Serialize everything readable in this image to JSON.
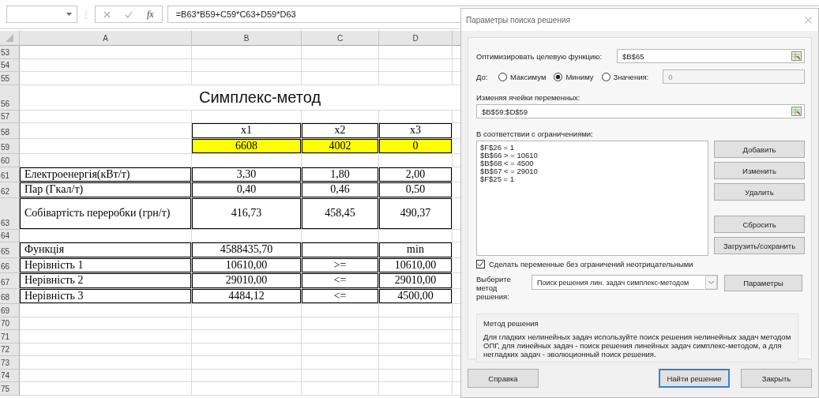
{
  "formula_bar": {
    "separator": "⋮",
    "function_symbol": "fx",
    "formula": "=B63*B59+C59*C63+D59*D63"
  },
  "sheet": {
    "columns": [
      "A",
      "B",
      "C",
      "D"
    ],
    "rows": [
      {
        "number": "53",
        "kind": "blank"
      },
      {
        "number": "54",
        "kind": "blank"
      },
      {
        "number": "55",
        "kind": "blank"
      },
      {
        "number": "56",
        "kind": "title",
        "title": "Симплекс-метод"
      },
      {
        "number": "57",
        "kind": "blank"
      },
      {
        "number": "58",
        "kind": "data",
        "highlighted": false,
        "cells": [
          {
            "boxed": false
          },
          {
            "text": "x1",
            "boxed": true
          },
          {
            "text": "x2",
            "boxed": true
          },
          {
            "text": "x3",
            "boxed": true
          }
        ]
      },
      {
        "number": "59",
        "kind": "data",
        "highlighted": true,
        "cells": [
          {
            "boxed": false
          },
          {
            "text": "6608",
            "boxed": true
          },
          {
            "text": "4002",
            "boxed": true
          },
          {
            "text": "0",
            "boxed": true
          }
        ]
      },
      {
        "number": "60",
        "kind": "blank"
      },
      {
        "number": "61",
        "kind": "data",
        "highlighted": false,
        "cells": [
          {
            "text": "Електроенергія(кВт/т)",
            "boxed": true
          },
          {
            "text": "3,30",
            "boxed": true
          },
          {
            "text": "1,80",
            "boxed": true
          },
          {
            "text": "2,00",
            "boxed": true
          }
        ]
      },
      {
        "number": "62",
        "kind": "data",
        "highlighted": false,
        "cells": [
          {
            "text": "Пар (Гкал/т)",
            "boxed": true
          },
          {
            "text": "0,40",
            "boxed": true
          },
          {
            "text": "0,46",
            "boxed": true
          },
          {
            "text": "0,50",
            "boxed": true
          }
        ]
      },
      {
        "number": "63",
        "kind": "tall",
        "highlighted": false,
        "cells": [
          {
            "text": "Собівартість переробки (грн/т)",
            "boxed": true
          },
          {
            "text": "416,73",
            "boxed": true
          },
          {
            "text": "458,45",
            "boxed": true
          },
          {
            "text": "490,37",
            "boxed": true
          }
        ]
      },
      {
        "number": "64",
        "kind": "blank"
      },
      {
        "number": "65",
        "kind": "data",
        "highlighted": false,
        "cells": [
          {
            "text": "Функція",
            "boxed": true
          },
          {
            "text": "4588435,70",
            "boxed": true
          },
          {
            "boxed": true
          },
          {
            "text": "min",
            "boxed": true
          }
        ]
      },
      {
        "number": "66",
        "kind": "data",
        "highlighted": false,
        "cells": [
          {
            "text": "Нерівність 1",
            "boxed": true
          },
          {
            "text": "10610,00",
            "boxed": true
          },
          {
            "text": ">=",
            "boxed": true
          },
          {
            "text": "10610,00",
            "boxed": true
          }
        ]
      },
      {
        "number": "67",
        "kind": "data",
        "highlighted": false,
        "cells": [
          {
            "text": "Нерівність 2",
            "boxed": true
          },
          {
            "text": "29010,00",
            "boxed": true
          },
          {
            "text": "<=",
            "boxed": true
          },
          {
            "text": "29010,00",
            "boxed": true
          }
        ]
      },
      {
        "number": "68",
        "kind": "data",
        "highlighted": false,
        "cells": [
          {
            "text": "Нерівність 3",
            "boxed": true
          },
          {
            "text": "4484,12",
            "boxed": true
          },
          {
            "text": "<=",
            "boxed": true
          },
          {
            "text": "4500,00",
            "boxed": true
          }
        ]
      },
      {
        "number": "69",
        "kind": "blank"
      },
      {
        "number": "70",
        "kind": "blank"
      },
      {
        "number": "71",
        "kind": "blank"
      },
      {
        "number": "72",
        "kind": "blank"
      },
      {
        "number": "73",
        "kind": "blank"
      },
      {
        "number": "74",
        "kind": "blank"
      },
      {
        "number": "75",
        "kind": "blank"
      }
    ]
  },
  "dialog": {
    "title": "Параметры поиска решения",
    "objective": {
      "label": "Оптимизировать целевую функцию:",
      "value": "$B$65"
    },
    "target": {
      "label": "До:",
      "options": [
        {
          "label": "Максимум",
          "selected": false
        },
        {
          "label": "Миниму",
          "selected": true
        },
        {
          "label": "Значения:",
          "selected": false
        }
      ],
      "value": "0",
      "value_disabled": true
    },
    "variables": {
      "label": "Изменяя ячейки переменных:",
      "value": "$B$59:$D$59"
    },
    "constraints": {
      "label": "В соответствии с ограничениями:",
      "items": [
        "$F$26 = 1",
        "$B$66 > = 10610",
        "$B$68 < = 4500",
        "$B$67 < = 29010",
        "$F$25 = 1"
      ]
    },
    "side_buttons": [
      "Добавить",
      "Изменить",
      "Удалить",
      "Сбросить",
      "Загрузить/сохранить"
    ],
    "nonnegative": {
      "label": "Сделать переменные без ограничений неотрицательными",
      "checked": true
    },
    "method": {
      "label": "Выберите метод решения:",
      "value": "Поиск решения лин. задач симплекс-методом",
      "options_button": "Параметры"
    },
    "method_info": {
      "title": "Метод решения",
      "text": "Для гладких нелинейных задач используйте поиск решения нелинейных задач методом ОПГ, для линейных задач - поиск решения линейных задач симплекс-методом, а для негладких задач - эволюционный поиск решения."
    },
    "footer_buttons": [
      {
        "label": "Справка",
        "default": false
      },
      {
        "label": "Найти решение",
        "default": true
      },
      {
        "label": "Закрыть",
        "default": false
      }
    ]
  }
}
